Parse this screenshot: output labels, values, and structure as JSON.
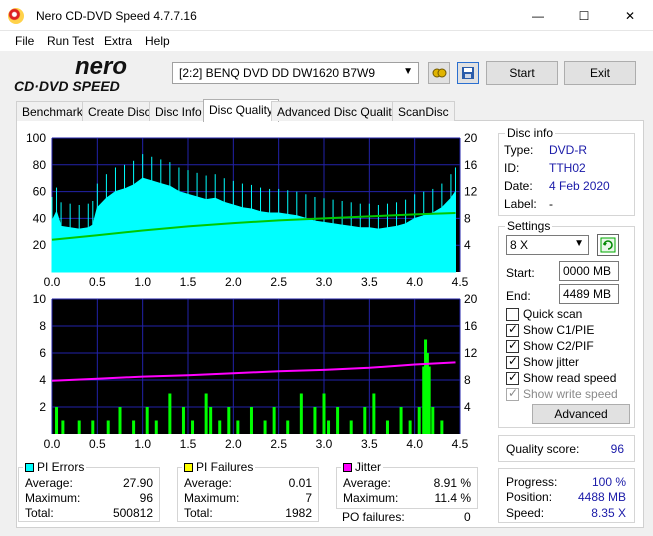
{
  "window": {
    "title": "Nero CD-DVD Speed 4.7.7.16",
    "minimize_glyph": "—",
    "maximize_glyph": "☐",
    "close_glyph": "✕"
  },
  "menu": [
    "File",
    "Run Test",
    "Extra",
    "Help"
  ],
  "logo": {
    "line1": "nero",
    "line2": "CD·DVD SPEED"
  },
  "drive": {
    "selected": "[2:2]   BENQ DVD DD DW1620 B7W9"
  },
  "toolbar": {
    "start_label": "Start",
    "exit_label": "Exit"
  },
  "tabs": [
    "Benchmark",
    "Create Disc",
    "Disc Info",
    "Disc Quality",
    "Advanced Disc Quality",
    "ScanDisc"
  ],
  "active_tab": "Disc Quality",
  "disc_info": {
    "title": "Disc info",
    "type_label": "Type:",
    "type_value": "DVD-R",
    "id_label": "ID:",
    "id_value": "TTH02",
    "date_label": "Date:",
    "date_value": "4 Feb 2020",
    "label_label": "Label:",
    "label_value": "-"
  },
  "settings": {
    "title": "Settings",
    "speed": "8 X",
    "start_label": "Start:",
    "start_value": "0000 MB",
    "end_label": "End:",
    "end_value": "4489 MB",
    "checkboxes": [
      {
        "label": "Quick scan",
        "checked": false,
        "enabled": true
      },
      {
        "label": "Show C1/PIE",
        "checked": true,
        "enabled": true
      },
      {
        "label": "Show C2/PIF",
        "checked": true,
        "enabled": true
      },
      {
        "label": "Show jitter",
        "checked": true,
        "enabled": true
      },
      {
        "label": "Show read speed",
        "checked": true,
        "enabled": true
      },
      {
        "label": "Show write speed",
        "checked": true,
        "enabled": false
      }
    ],
    "advanced_label": "Advanced"
  },
  "quality": {
    "label": "Quality score:",
    "value": "96"
  },
  "progress": {
    "progress_label": "Progress:",
    "progress_value": "100 %",
    "position_label": "Position:",
    "position_value": "4488 MB",
    "speed_label": "Speed:",
    "speed_value": "8.35 X"
  },
  "pi_errors": {
    "title": "PI Errors",
    "color": "#00ffff",
    "avg_label": "Average:",
    "avg": "27.90",
    "max_label": "Maximum:",
    "max": "96",
    "total_label": "Total:",
    "total": "500812"
  },
  "pi_failures": {
    "title": "PI Failures",
    "color": "#ffff00",
    "avg_label": "Average:",
    "avg": "0.01",
    "max_label": "Maximum:",
    "max": "7",
    "total_label": "Total:",
    "total": "1982"
  },
  "jitter": {
    "title": "Jitter",
    "color": "#ff00ff",
    "avg_label": "Average:",
    "avg": "8.91 %",
    "max_label": "Maximum:",
    "max": "11.4 %",
    "pof_label": "PO failures:",
    "pof": "0"
  },
  "chart_data": [
    {
      "type": "area",
      "x_ticks": [
        "0.0",
        "0.5",
        "1.0",
        "1.5",
        "2.0",
        "2.5",
        "3.0",
        "3.5",
        "4.0",
        "4.5"
      ],
      "y_left_ticks": [
        "100",
        "80",
        "60",
        "40",
        "20"
      ],
      "y_right_ticks": [
        "20",
        "16",
        "12",
        "8",
        "4"
      ],
      "xlim": [
        0,
        4.5
      ],
      "ylim_left": [
        0,
        100
      ],
      "ylim_right": [
        0,
        20
      ],
      "series": [
        {
          "color": "#00ffff",
          "x": [
            0,
            0.05,
            0.1,
            0.2,
            0.3,
            0.4,
            0.45,
            0.5,
            0.6,
            0.7,
            0.8,
            0.9,
            1.0,
            1.1,
            1.2,
            1.3,
            1.4,
            1.5,
            1.6,
            1.7,
            1.8,
            1.9,
            2.0,
            2.1,
            2.2,
            2.3,
            2.4,
            2.5,
            2.6,
            2.7,
            2.8,
            2.9,
            3.0,
            3.1,
            3.2,
            3.3,
            3.4,
            3.5,
            3.6,
            3.7,
            3.8,
            3.9,
            4.0,
            4.1,
            4.2,
            4.3,
            4.4,
            4.45
          ],
          "y": [
            38,
            45,
            34,
            33,
            32,
            33,
            35,
            48,
            55,
            60,
            62,
            65,
            70,
            68,
            66,
            64,
            60,
            58,
            56,
            54,
            55,
            52,
            50,
            48,
            47,
            45,
            44,
            44,
            43,
            42,
            40,
            38,
            37,
            36,
            35,
            34,
            33,
            33,
            32,
            33,
            34,
            36,
            40,
            42,
            44,
            48,
            55,
            60
          ]
        },
        {
          "color": "#00c800",
          "x": [
            0,
            0.5,
            1.0,
            1.5,
            2.0,
            2.5,
            3.0,
            3.5,
            4.0,
            4.45
          ],
          "y": [
            4.8,
            5.5,
            6.2,
            6.8,
            7.3,
            7.7,
            8.0,
            8.3,
            8.6,
            8.8
          ],
          "axis": "right"
        }
      ]
    },
    {
      "type": "bar",
      "x_ticks": [
        "0.0",
        "0.5",
        "1.0",
        "1.5",
        "2.0",
        "2.5",
        "3.0",
        "3.5",
        "4.0",
        "4.5"
      ],
      "y_left_ticks": [
        "10",
        "8",
        "6",
        "4",
        "2"
      ],
      "y_right_ticks": [
        "20",
        "16",
        "12",
        "8",
        "4"
      ],
      "xlim": [
        0,
        4.5
      ],
      "ylim_left": [
        0,
        10
      ],
      "ylim_right": [
        0,
        20
      ],
      "series": [
        {
          "color": "#00ff00",
          "x": [
            0.05,
            0.12,
            0.3,
            0.45,
            0.62,
            0.75,
            0.9,
            1.05,
            1.15,
            1.3,
            1.45,
            1.55,
            1.7,
            1.75,
            1.85,
            1.95,
            2.05,
            2.2,
            2.35,
            2.45,
            2.6,
            2.75,
            2.9,
            3.0,
            3.05,
            3.15,
            3.3,
            3.45,
            3.55,
            3.7,
            3.85,
            3.95,
            4.05,
            4.1,
            4.12,
            4.14,
            4.16,
            4.2,
            4.3
          ],
          "y": [
            2,
            1,
            1,
            1,
            1,
            2,
            1,
            2,
            1,
            3,
            2,
            1,
            3,
            2,
            1,
            2,
            1,
            2,
            1,
            2,
            1,
            3,
            2,
            3,
            1,
            2,
            1,
            2,
            3,
            1,
            2,
            1,
            2,
            5,
            7,
            6,
            5,
            2,
            1
          ]
        },
        {
          "color": "#ff00ff",
          "axis": "right",
          "x": [
            0,
            0.5,
            1.0,
            1.5,
            2.0,
            2.5,
            3.0,
            3.5,
            4.0,
            4.45
          ],
          "y": [
            7.9,
            8.2,
            8.5,
            8.7,
            9.0,
            9.3,
            9.5,
            9.8,
            10.3,
            10.6
          ]
        }
      ]
    }
  ]
}
